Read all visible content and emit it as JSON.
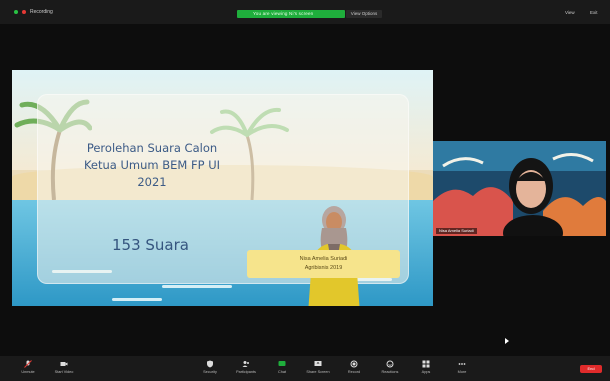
{
  "topbar": {
    "recording_label": "Recording",
    "share_status": "You are viewing Ni's screen",
    "share_options": "View Options",
    "view_label": "View",
    "exit_label": "Exit"
  },
  "slide": {
    "title_lines": [
      "Perolehan Suara Calon",
      "Ketua Umum BEM FP UI",
      "2021"
    ],
    "vote_count": "153 Suara",
    "caption_lines": [
      "Nisa Amelia Suriadi",
      "Agribisnis 2019"
    ]
  },
  "video": {
    "participant_name": "Nisa Amelia Suriadi"
  },
  "toolbar": {
    "items": [
      {
        "label": "Unmute"
      },
      {
        "label": "Start Video"
      },
      {
        "label": "Security"
      },
      {
        "label": "Participants"
      },
      {
        "label": "Chat"
      },
      {
        "label": "Share Screen"
      },
      {
        "label": "Record"
      },
      {
        "label": "Reactions"
      },
      {
        "label": "Apps"
      },
      {
        "label": "More"
      }
    ],
    "end_label": "End"
  },
  "colors": {
    "share_green": "#1fae3c",
    "end_red": "#e02b2b",
    "mic_red": "#e53935"
  }
}
